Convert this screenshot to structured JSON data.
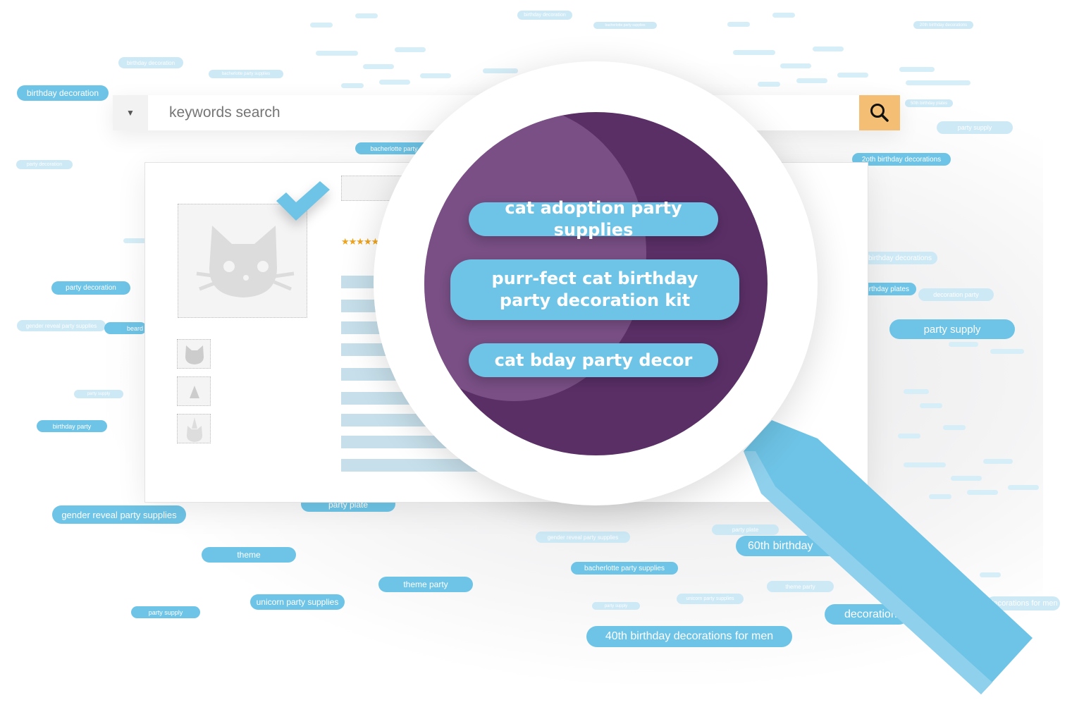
{
  "search": {
    "placeholder": "keywords search",
    "dropdown_icon": "caret-down-icon",
    "button_icon": "magnifier-icon",
    "button_color": "#f4bf74"
  },
  "tags": [
    "birthday decoration",
    "birthday decoration",
    "bacherlotte party supplies",
    "party decoration",
    "party decoration",
    "gender reveal party supplies",
    "beard",
    "birthday party",
    "party supply",
    "gender reveal party supplies",
    "theme",
    "theme party",
    "unicorn party supplies",
    "party supply",
    "party plate",
    "bacherlotte party",
    "birthday decoration",
    "bacherlotte party supplies",
    "20th birthday decorations",
    "2oth birthday decorations",
    "party supply",
    "50th birthday plates",
    "birthday decorations",
    "birthday plates",
    "decoration party",
    "party supply",
    "gender reveal party supplies",
    "party plate",
    "60th birthday",
    "bacherlotte party supplies",
    "theme party",
    "party supply",
    "unicorn party supplies",
    "40th birthday decorations for men",
    "decoration",
    "decorations for men"
  ],
  "product": {
    "rating_stars": 4,
    "main_image_icon": "cat-icon"
  },
  "lens": {
    "keywords": [
      "cat adoption party supplies",
      "purr-fect cat birthday party decoration kit",
      "cat bday party decor"
    ],
    "lens_color": "#5a2f66",
    "tag_color": "#6ec4e6"
  },
  "colors": {
    "tag_strong": "#6ec4e6",
    "tag_light": "#cde9f6",
    "check": "#6ec4e6"
  }
}
